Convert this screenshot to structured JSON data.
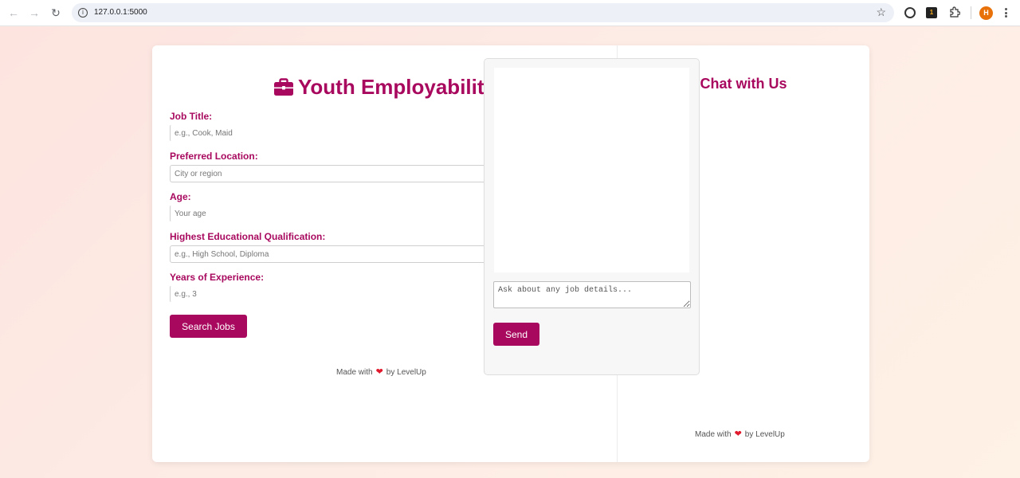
{
  "browser": {
    "url": "127.0.0.1:5000",
    "avatar_letter": "H"
  },
  "form": {
    "title": "Youth Employability",
    "fields": [
      {
        "label": "Job Title:",
        "placeholder": "e.g., Cook, Maid"
      },
      {
        "label": "Preferred Location:",
        "placeholder": "City or region"
      },
      {
        "label": "Age:",
        "placeholder": "Your age"
      },
      {
        "label": "Highest Educational Qualification:",
        "placeholder": "e.g., High School, Diploma"
      },
      {
        "label": "Years of Experience:",
        "placeholder": "e.g., 3"
      }
    ],
    "search_button": "Search Jobs",
    "footer_made_with": "Made with",
    "footer_by": "by LevelUp"
  },
  "chat": {
    "title": "Chat with Us",
    "input_placeholder": "Ask about any job details...",
    "send_button": "Send",
    "footer_made_with": "Made with",
    "footer_by": "by LevelUp"
  },
  "colors": {
    "accent": "#a8095e",
    "heart": "#e0192c"
  }
}
